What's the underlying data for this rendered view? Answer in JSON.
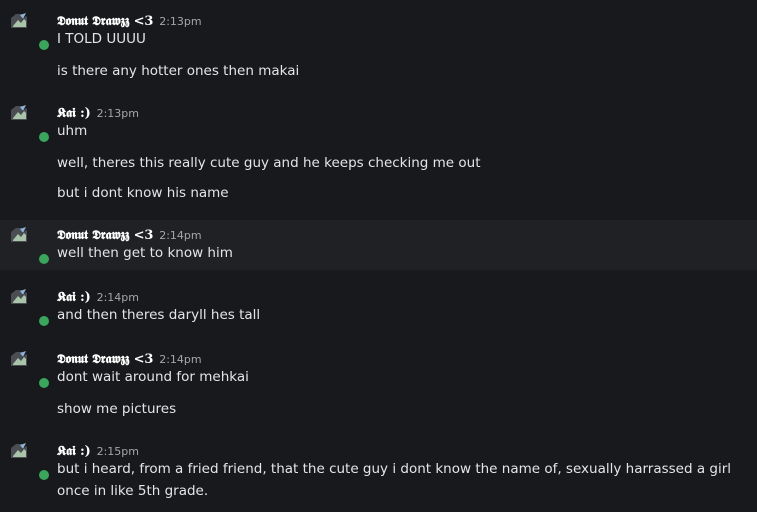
{
  "colors": {
    "background": "#18191c",
    "hover_background": "#1f2125",
    "online_status": "#3ba55c",
    "username": "#ffffff",
    "timestamp": "#a3a6aa",
    "message_text": "#e3e5e8"
  },
  "messages": [
    {
      "author": "𝕯𝖔𝖓𝖚𝖙 𝕯𝖗𝖆𝖜𝖟𝖟 <3",
      "time": "2:13pm",
      "lines": [
        "I TOLD UUUU",
        "is there any hotter ones then makai"
      ]
    },
    {
      "author": "𝕶𝖆𝖎 :)",
      "time": "2:13pm",
      "lines": [
        "uhm",
        "well, theres this really cute guy and he keeps checking me out",
        "but i dont know his name"
      ]
    },
    {
      "author": "𝕯𝖔𝖓𝖚𝖙 𝕯𝖗𝖆𝖜𝖟𝖟 <3",
      "time": "2:14pm",
      "lines": [
        "well then get to know him"
      ]
    },
    {
      "author": "𝕶𝖆𝖎 :)",
      "time": "2:14pm",
      "lines": [
        "and then theres daryll hes tall"
      ]
    },
    {
      "author": "𝕯𝖔𝖓𝖚𝖙 𝕯𝖗𝖆𝖜𝖟𝖟 <3",
      "time": "2:14pm",
      "lines": [
        "dont wait around for mehkai",
        "show me pictures"
      ]
    },
    {
      "author": "𝕶𝖆𝖎 :)",
      "time": "2:15pm",
      "lines": [
        "but i heard, from a fried friend, that the cute guy i dont know the name of, sexually harrassed a girl once in like 5th grade."
      ]
    }
  ]
}
